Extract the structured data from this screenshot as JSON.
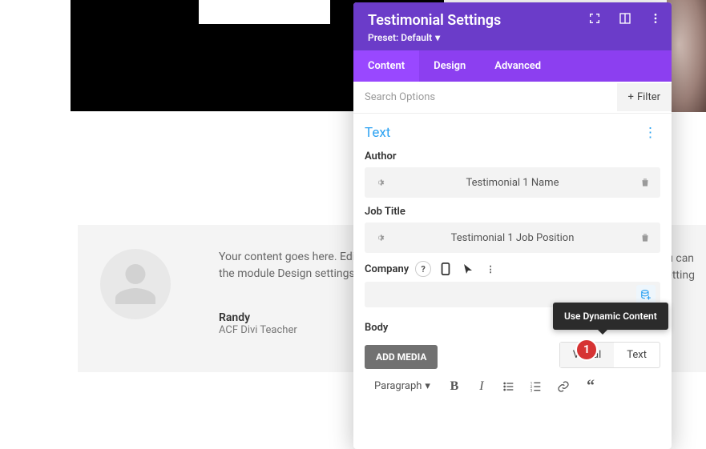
{
  "panel": {
    "title": "Testimonial Settings",
    "preset_label": "Preset: Default",
    "tabs": {
      "content": "Content",
      "design": "Design",
      "advanced": "Advanced"
    },
    "search_placeholder": "Search Options",
    "filter_label": "Filter",
    "section_title": "Text",
    "fields": {
      "author": {
        "label": "Author",
        "value": "Testimonial 1 Name"
      },
      "job_title": {
        "label": "Job Title",
        "value": "Testimonial 1 Job Position"
      },
      "company": {
        "label": "Company"
      },
      "body": {
        "label": "Body"
      }
    },
    "editor": {
      "add_media": "ADD MEDIA",
      "visual_tab": "Visual",
      "text_tab": "Text",
      "format": "Paragraph"
    },
    "tooltip": "Use Dynamic Content"
  },
  "card": {
    "content": "Your content goes here. Edit or remove this text inline or in the module Content settings. You can also style every aspect of this content in the module Design settings and even apply custom CSS to this text in the module Advanced settings.",
    "content_short_l1": "Your content goes here. Edit o",
    "content_short_l2": "the module Design settings ar",
    "content_short_r1": "ou can",
    "content_short_r2": "setting",
    "author": "Randy",
    "job": "ACF Divi Teacher"
  },
  "callouts": {
    "1": "1"
  }
}
